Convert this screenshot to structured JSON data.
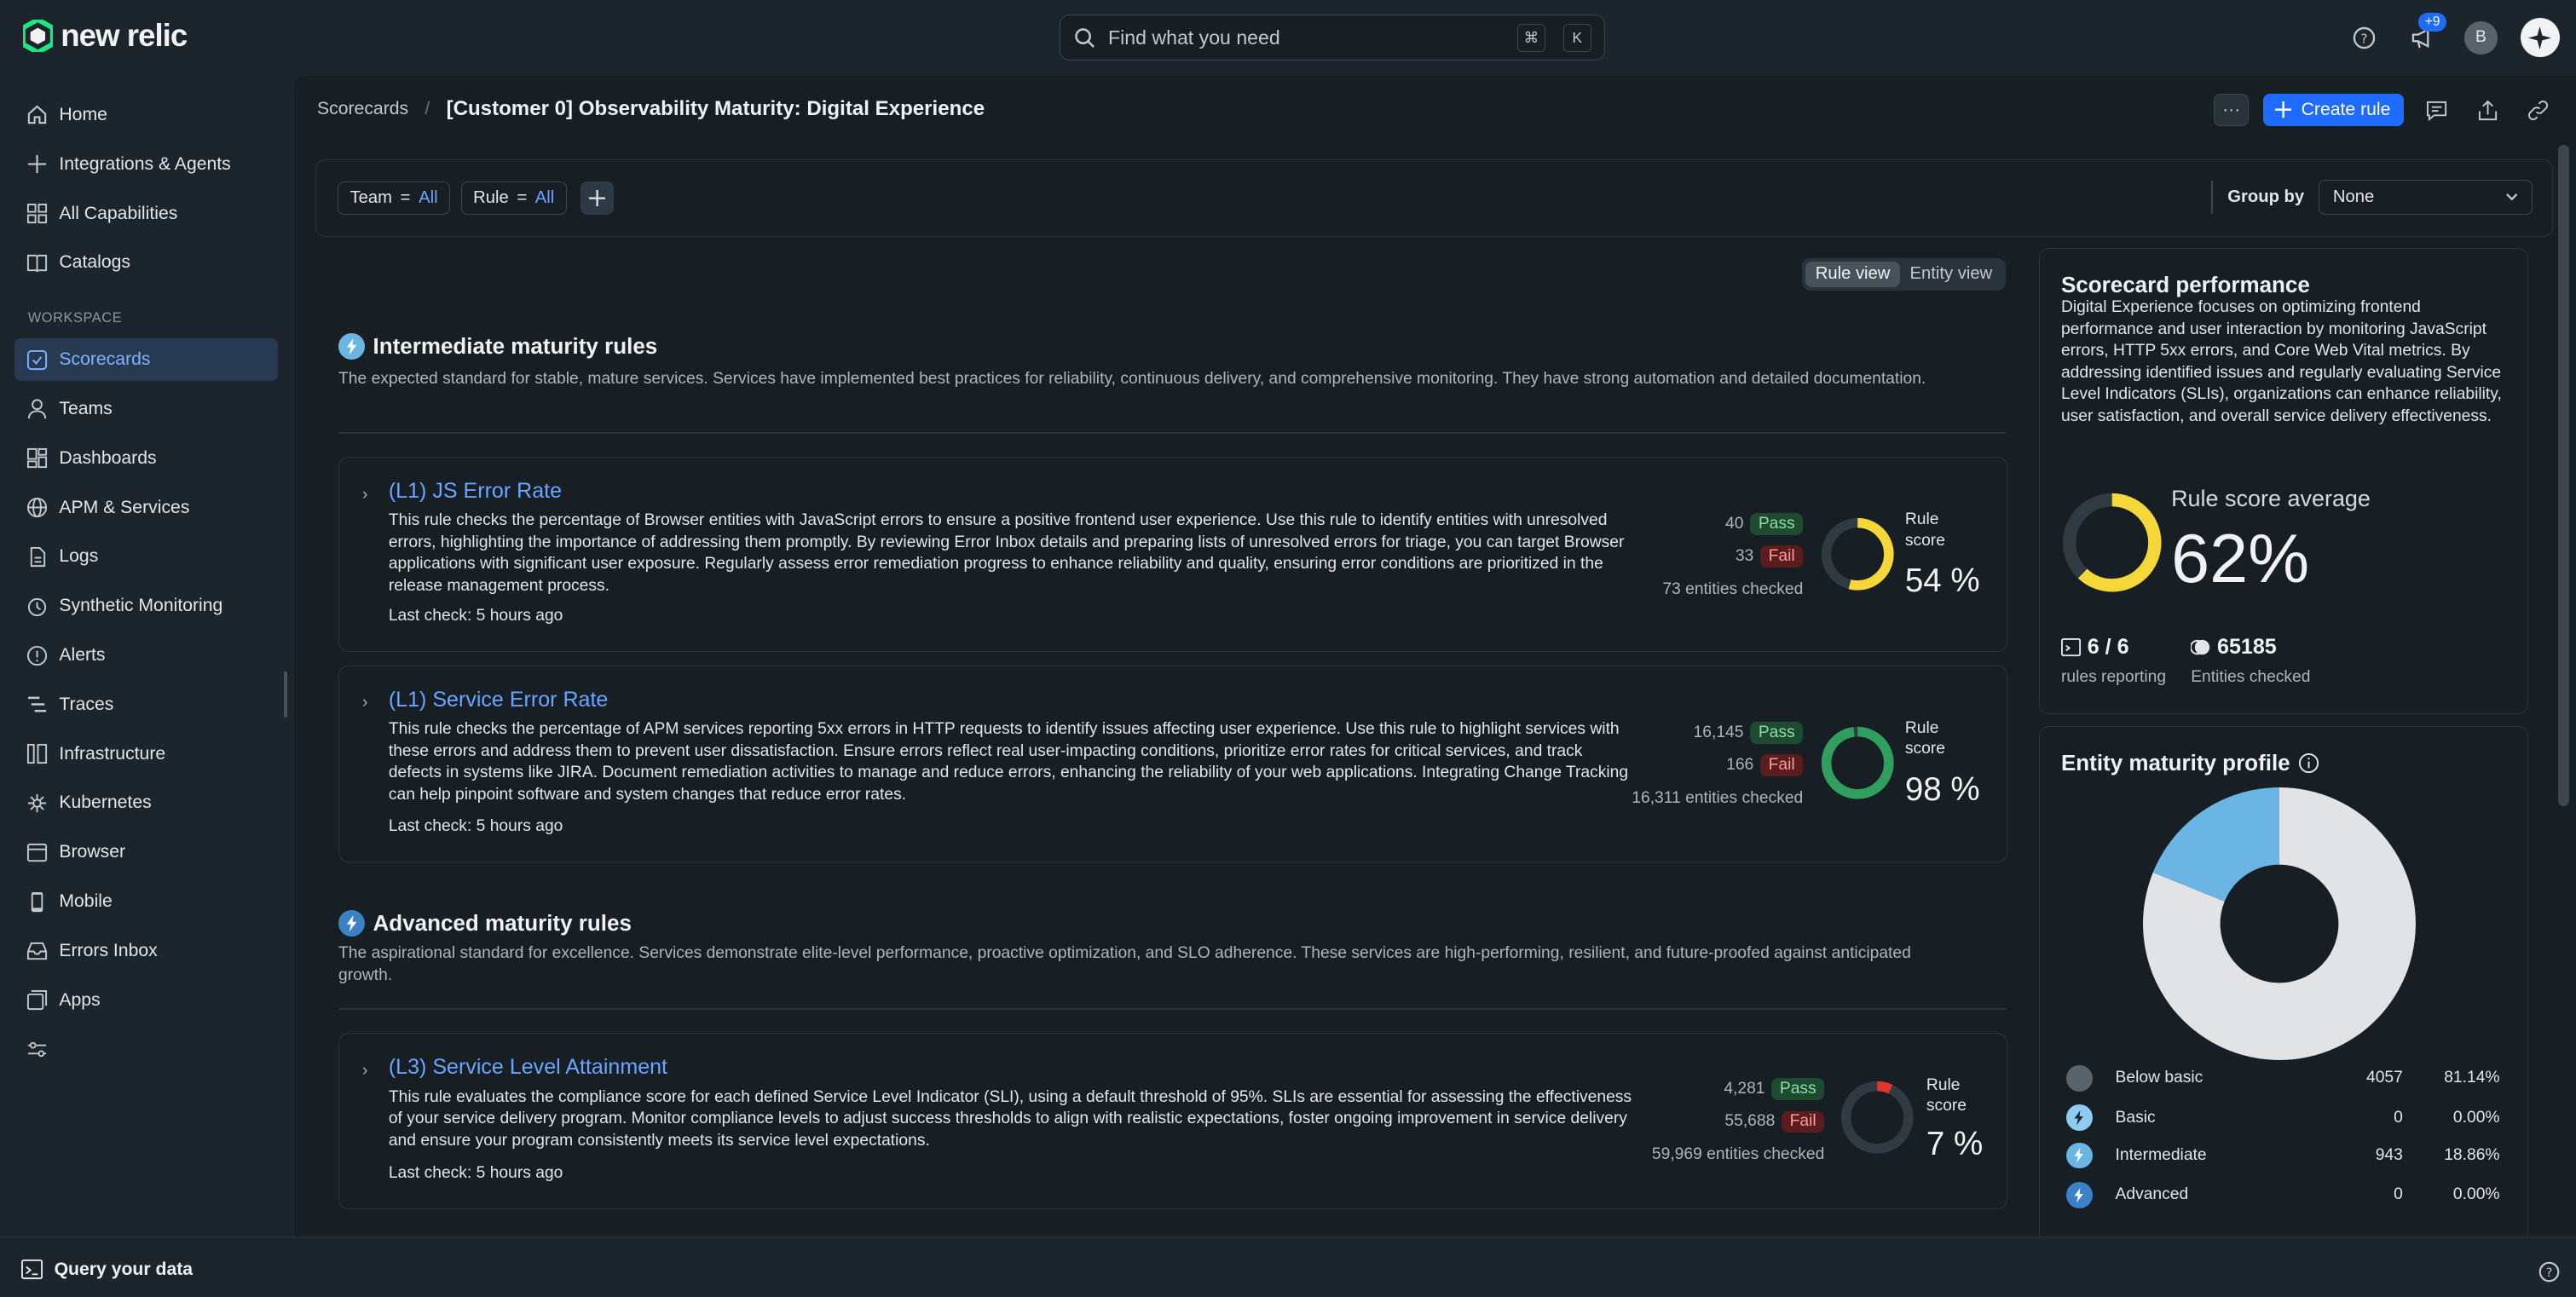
{
  "brand": {
    "name": "new relic",
    "accent": "#1ce783"
  },
  "search": {
    "placeholder": "Find what you need",
    "key1": "⌘",
    "key2": "K"
  },
  "topbar": {
    "notif_badge": "+9",
    "avatar_initial": "B"
  },
  "nav": {
    "home": "Home",
    "integrations": "Integrations & Agents",
    "capabilities": "All Capabilities",
    "catalogs": "Catalogs",
    "workspace_label": "WORKSPACE",
    "scorecards": "Scorecards",
    "teams": "Teams",
    "dashboards": "Dashboards",
    "apm": "APM & Services",
    "logs": "Logs",
    "synthetic": "Synthetic Monitoring",
    "alerts": "Alerts",
    "traces": "Traces",
    "infrastructure": "Infrastructure",
    "kubernetes": "Kubernetes",
    "browser": "Browser",
    "mobile": "Mobile",
    "errors": "Errors Inbox",
    "apps": "Apps"
  },
  "breadcrumb": {
    "parent": "Scorecards",
    "sep": "/",
    "current": "[Customer 0] Observability Maturity: Digital Experience"
  },
  "header": {
    "more": "···",
    "create_rule": "Create rule"
  },
  "filters": {
    "team_key": "Team",
    "team_op": "=",
    "team_val": "All",
    "rule_key": "Rule",
    "rule_op": "=",
    "rule_val": "All",
    "group_by_label": "Group by",
    "group_by_value": "None"
  },
  "view_toggle": {
    "rule": "Rule view",
    "entity": "Entity view"
  },
  "sections": [
    {
      "title": "Intermediate maturity rules",
      "desc": "The expected standard for stable, mature services. Services have implemented best practices for reliability, continuous delivery, and comprehensive monitoring. They have strong automation and detailed documentation.",
      "rules": [
        {
          "title": "(L1) JS Error Rate",
          "desc": "This rule checks the percentage of Browser entities with JavaScript errors to ensure a positive frontend user experience. Use this rule to identify entities with unresolved errors, highlighting the importance of addressing them promptly. By reviewing Error Inbox details and preparing lists of unresolved errors for triage, you can target Browser applications with significant user exposure. Regularly assess error remediation progress to enhance reliability and quality, ensuring error conditions are prioritized in the release management process.",
          "last_check": "Last check: 5 hours ago",
          "pass_count": "40",
          "pass_label": "Pass",
          "fail_count": "33",
          "fail_label": "Fail",
          "checked": "73 entities checked",
          "score_label": "Rule score",
          "score": "54 %",
          "score_pct": 54,
          "color": "#f5d73a"
        },
        {
          "title": "(L1) Service Error Rate",
          "desc": "This rule checks the percentage of APM services reporting 5xx errors in HTTP requests to identify issues affecting user experience. Use this rule to highlight services with these errors and address them to prevent user dissatisfaction. Ensure errors reflect real user-impacting conditions, prioritize error rates for critical services, and track defects in systems like JIRA. Document remediation activities to manage and reduce errors, enhancing the reliability of your web applications. Integrating Change Tracking can help pinpoint software and system changes that reduce error rates.",
          "last_check": "Last check: 5 hours ago",
          "pass_count": "16,145",
          "pass_label": "Pass",
          "fail_count": "166",
          "fail_label": "Fail",
          "checked": "16,311 entities checked",
          "score_label": "Rule score",
          "score": "98 %",
          "score_pct": 98,
          "color": "#2f9e5f"
        }
      ]
    },
    {
      "title": "Advanced maturity rules",
      "desc": "The aspirational standard for excellence. Services demonstrate elite-level performance, proactive optimization, and SLO adherence. These services are high-performing, resilient, and future-proofed against anticipated growth.",
      "rules": [
        {
          "title": "(L3) Service Level Attainment",
          "desc": "This rule evaluates the compliance score for each defined Service Level Indicator (SLI), using a default threshold of 95%. SLIs are essential for assessing the effectiveness of your service delivery program. Monitor compliance levels to adjust success thresholds to align with realistic expectations, foster ongoing improvement in service delivery and ensure your program consistently meets its service level expectations.",
          "last_check": "Last check: 5 hours ago",
          "pass_count": "4,281",
          "pass_label": "Pass",
          "fail_count": "55,688",
          "fail_label": "Fail",
          "checked": "59,969 entities checked",
          "score_label": "Rule score",
          "score": "7 %",
          "score_pct": 7,
          "color": "#e0362c"
        }
      ]
    }
  ],
  "performance": {
    "title": "Scorecard performance",
    "desc": "Digital Experience focuses on optimizing frontend performance and user interaction by monitoring JavaScript errors, HTTP 5xx errors, and Core Web Vital metrics. By addressing identified issues and regularly evaluating Service Level Indicators (SLIs), organizations can enhance reliability, user satisfaction, and overall service delivery effectiveness.",
    "avg_label": "Rule score average",
    "avg_value": "62%",
    "avg_pct": 62,
    "rules_reporting": "6 / 6",
    "rules_reporting_label": "rules reporting",
    "entities_checked": "65185",
    "entities_checked_label": "Entities checked"
  },
  "maturity": {
    "title": "Entity maturity profile",
    "chart_data": {
      "type": "pie",
      "categories": [
        "Below basic",
        "Basic",
        "Intermediate",
        "Advanced"
      ],
      "values": [
        4057,
        0,
        943,
        0
      ],
      "percents": [
        "81.14%",
        "0.00%",
        "18.86%",
        "0.00%"
      ],
      "colors": [
        "#e1e3e4",
        "#8ecbf0",
        "#6ab5e3",
        "#3b82c4"
      ]
    },
    "rows": [
      {
        "name": "Below basic",
        "count": "4057",
        "pct": "81.14%"
      },
      {
        "name": "Basic",
        "count": "0",
        "pct": "0.00%"
      },
      {
        "name": "Intermediate",
        "count": "943",
        "pct": "18.86%"
      },
      {
        "name": "Advanced",
        "count": "0",
        "pct": "0.00%"
      }
    ]
  },
  "bottom": {
    "query": "Query your data"
  }
}
